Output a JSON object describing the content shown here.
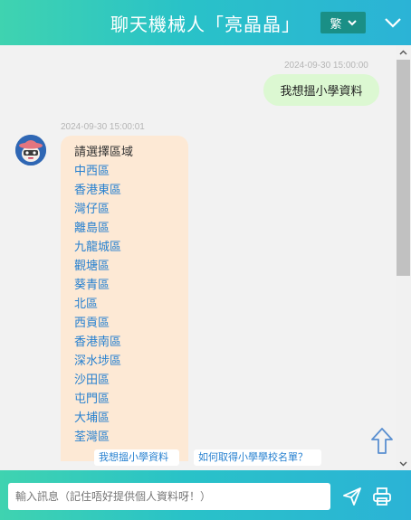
{
  "header": {
    "title": "聊天機械人「亮晶晶」",
    "language_label": "繁",
    "colors": {
      "gradient_start": "#3fd3b0",
      "gradient_end": "#2bb3d6",
      "language_button": "#1a8f86"
    }
  },
  "chat": {
    "user_message": {
      "timestamp": "2024-09-30 15:00:00",
      "text": "我想搵小學資料"
    },
    "bot_message": {
      "timestamp": "2024-09-30 15:00:01",
      "intro": "請選擇區域",
      "districts": [
        "中西區",
        "香港東區",
        "灣仔區",
        "離島區",
        "九龍城區",
        "觀塘區",
        "葵青區",
        "北區",
        "西貢區",
        "香港南區",
        "深水埗區",
        "沙田區",
        "屯門區",
        "大埔區",
        "荃灣區"
      ]
    },
    "quick_replies": [
      "我想搵小學資料",
      "如何取得小學學校名單？"
    ],
    "colors": {
      "user_bubble": "#dcf8d2",
      "bot_bubble": "#fde9d5",
      "link": "#2680d0"
    }
  },
  "footer": {
    "input_placeholder": "輸入訊息（記住唔好提供個人資料呀！）",
    "input_value": ""
  },
  "icons": {
    "language_dropdown": "chevron-down-icon",
    "collapse": "chevron-down-icon",
    "scroll_top": "arrow-up-icon",
    "send": "paper-plane-icon",
    "print": "printer-icon",
    "avatar": "robot-cowboy-avatar"
  }
}
